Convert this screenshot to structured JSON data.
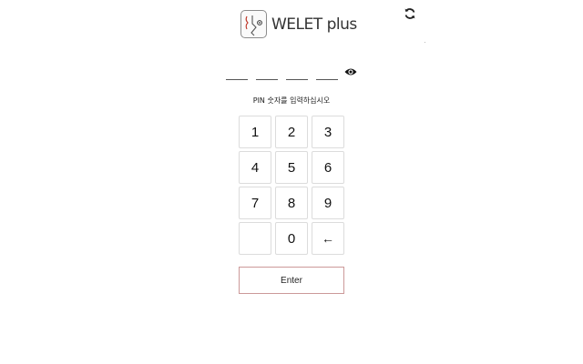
{
  "app": {
    "name": "WELET",
    "name_suffix": "plus",
    "logo_icon": "welet-face-logo-icon"
  },
  "header": {
    "refresh_icon": "refresh-icon"
  },
  "pin": {
    "length": 4,
    "entered_digits": 0,
    "toggle_visibility_icon": "eye-icon",
    "prompt": "PIN 숫자를 입력하십시오"
  },
  "keypad": {
    "keys": [
      "1",
      "2",
      "3",
      "4",
      "5",
      "6",
      "7",
      "8",
      "9",
      "",
      "0",
      "←"
    ]
  },
  "actions": {
    "enter_label": "Enter"
  },
  "colors": {
    "accent": "#c0392b",
    "enter_border": "#cc9999",
    "key_border": "#dcdcdc"
  }
}
